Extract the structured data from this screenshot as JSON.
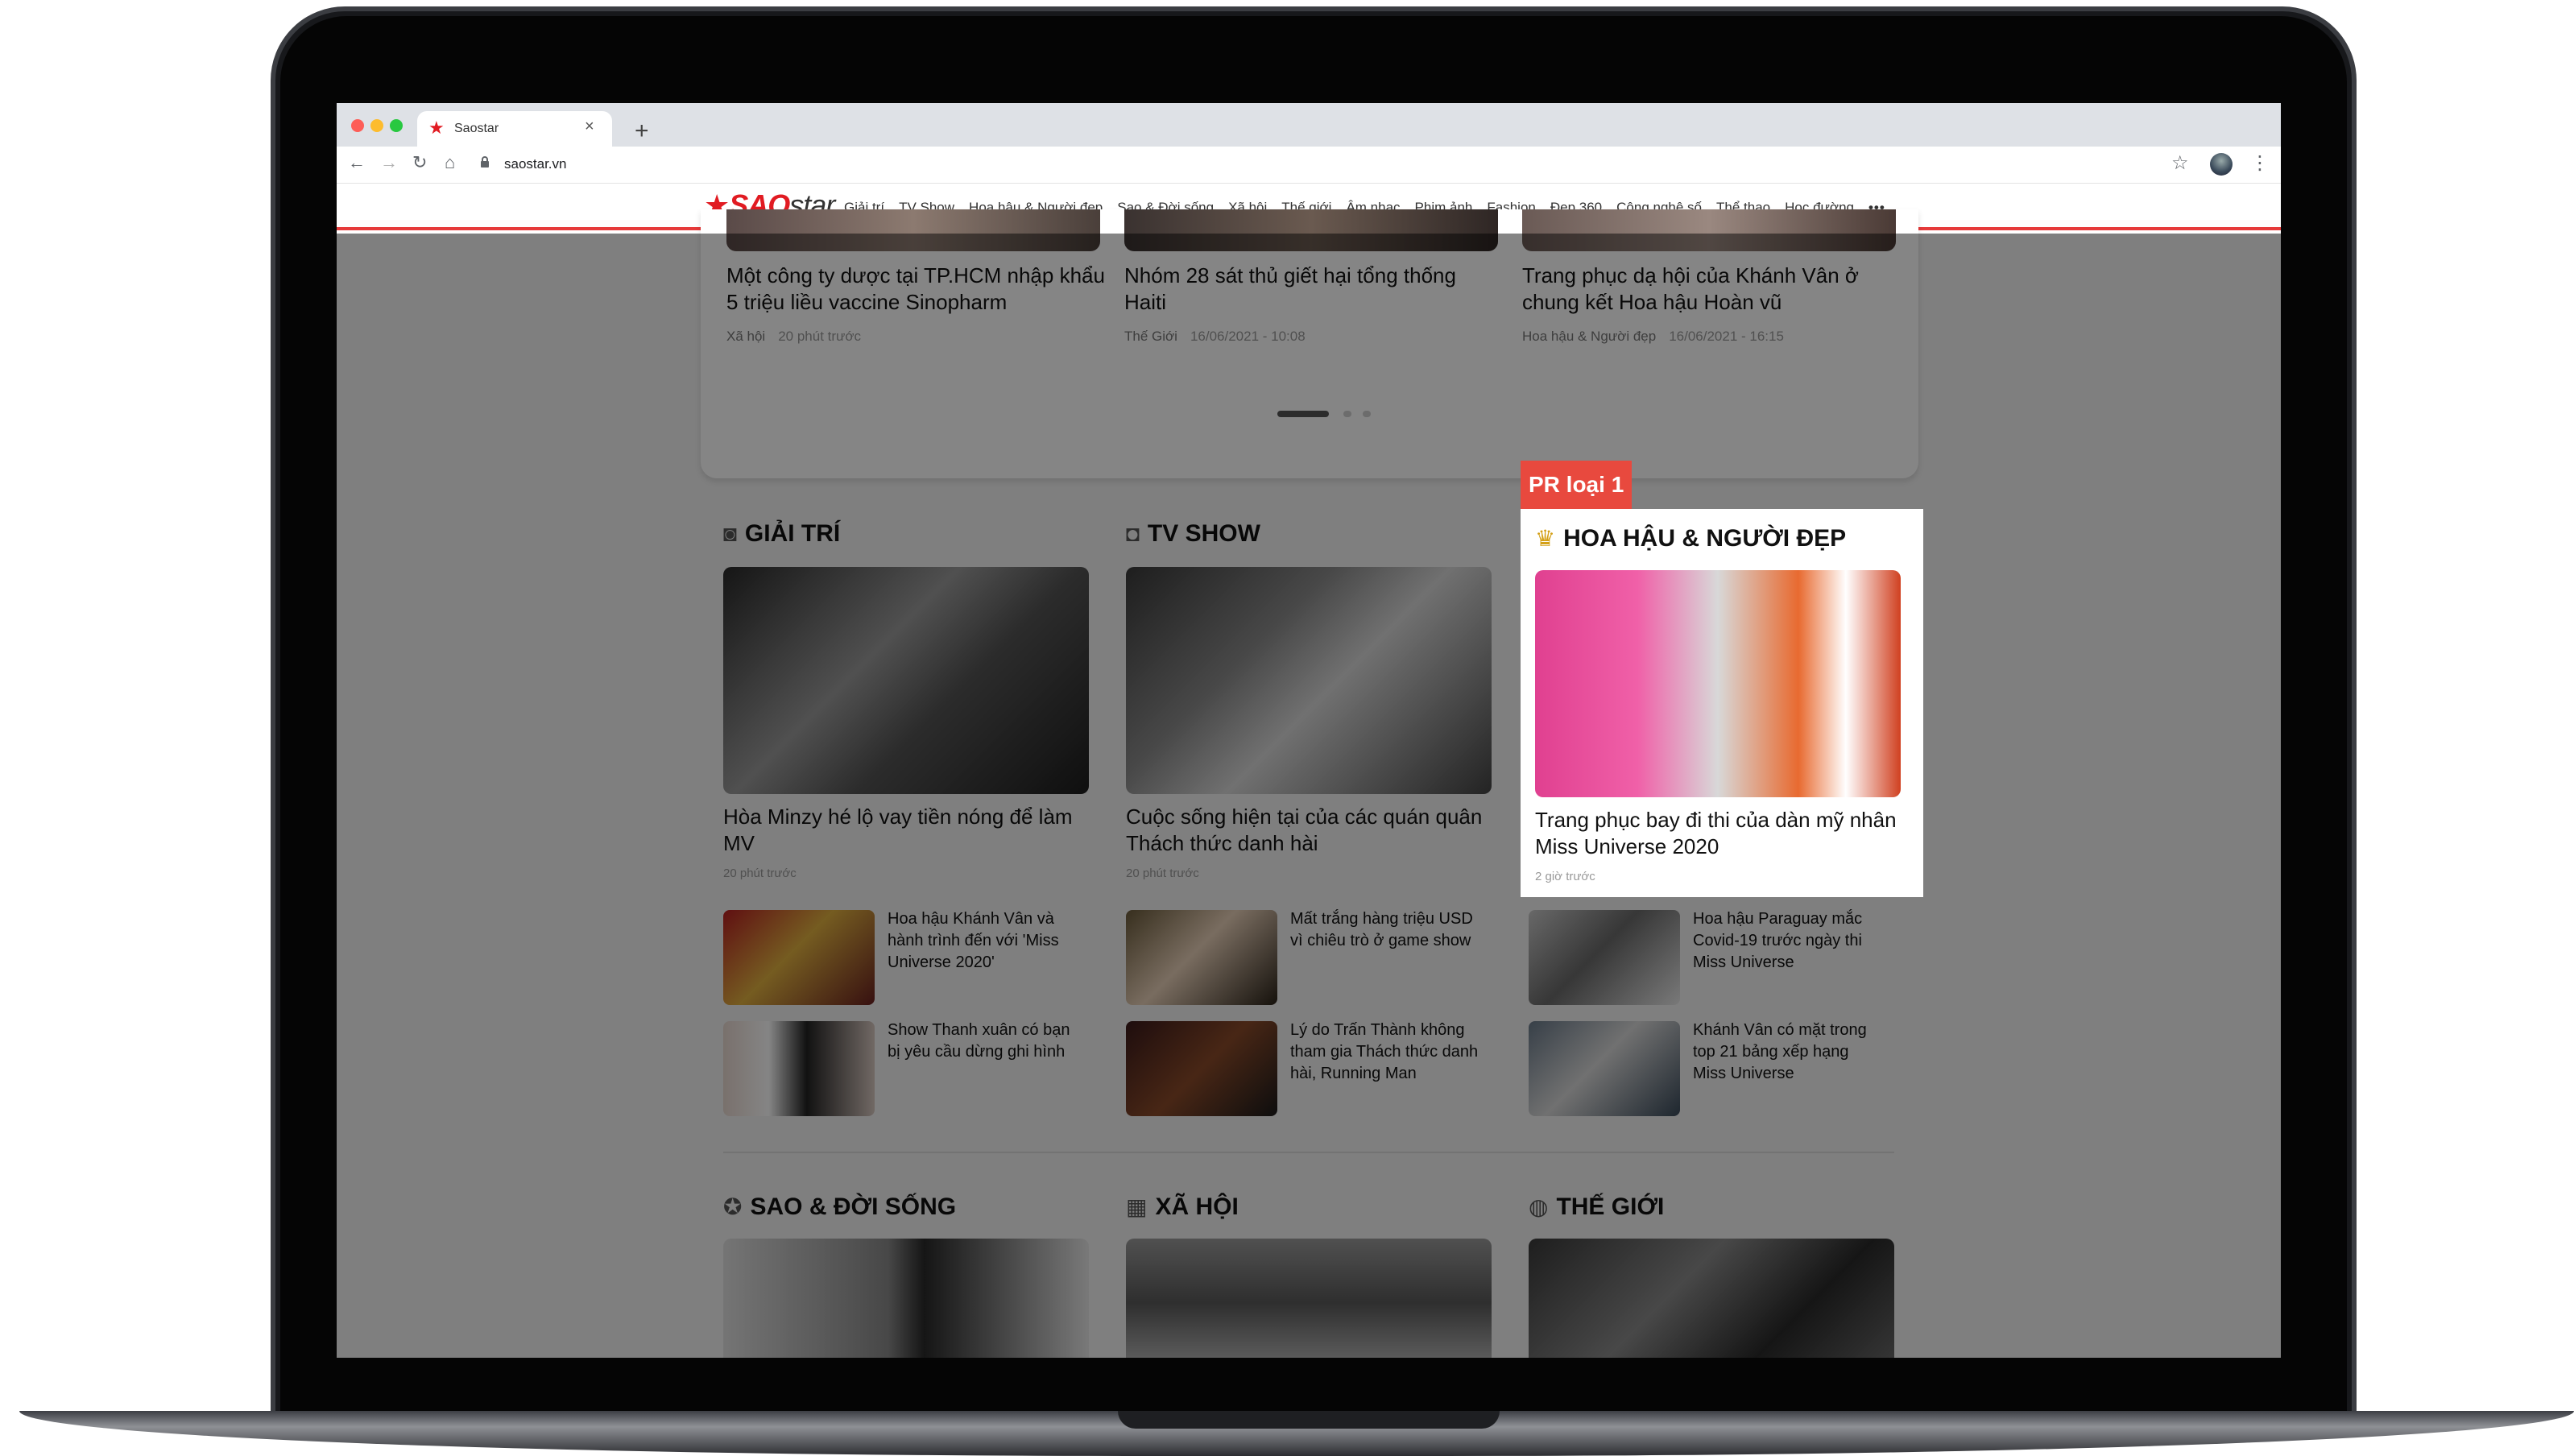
{
  "browser": {
    "tab_title": "Saostar",
    "tab_close": "×",
    "new_tab": "+",
    "url": "saostar.vn",
    "nav": {
      "back": "←",
      "forward": "→",
      "reload": "↻",
      "home": "⌂"
    },
    "lock_icon": "lock-icon",
    "star_icon": "☆",
    "menu_icon": "⋮"
  },
  "site": {
    "logo_star": "★",
    "logo_sao": "SAO",
    "logo_star_text": "star",
    "menu": [
      "Giải trí",
      "TV Show",
      "Hoa hậu & Người đẹp",
      "Sao & Đời sống",
      "Xã hội",
      "Thế giới",
      "Âm nhạc",
      "Phim ảnh",
      "Fashion",
      "Đẹp 360",
      "Công nghệ số",
      "Thể thao",
      "Học đường"
    ],
    "menu_more": "•••",
    "accent": "#e11b22"
  },
  "top_articles": [
    {
      "title": "Một công ty dược tại TP.HCM nhập khẩu 5 triệu liều vaccine Sinopharm",
      "category": "Xã hội",
      "time": "20 phút trước"
    },
    {
      "title": "Nhóm 28 sát thủ giết hại tổng thống Haiti",
      "category": "Thế Giới",
      "time": "16/06/2021 - 10:08"
    },
    {
      "title": "Trang phục dạ hội của Khánh Vân ở chung kết Hoa hậu Hoàn vũ",
      "category": "Hoa hậu & Người đẹp",
      "time": "16/06/2021 - 16:15"
    }
  ],
  "pr_label": "PR loại 1",
  "sections": [
    {
      "icon": "camera-icon",
      "icon_glyph": "◙",
      "title": "GIẢI TRÍ",
      "main_title": "Hòa Minzy hé lộ vay tiền nóng để làm MV",
      "main_time": "20 phút trước",
      "items": [
        "Hoa hậu Khánh Vân và hành trình đến với 'Miss Universe 2020'",
        "Show Thanh xuân có bạn bị yêu cầu dừng ghi hình"
      ]
    },
    {
      "icon": "tv-icon",
      "icon_glyph": "◘",
      "title": "TV SHOW",
      "main_title": "Cuộc sống hiện tại của các quán quân Thách thức danh hài",
      "main_time": "20 phút trước",
      "items": [
        "Mất trắng hàng triệu USD vì chiêu trò ở game show",
        "Lý do Trấn Thành không tham gia Thách thức danh hài, Running Man"
      ]
    },
    {
      "icon": "crown-icon",
      "icon_glyph": "♛",
      "title": "HOA HẬU & NGƯỜI ĐẸP",
      "main_title": "Trang phục bay đi thi của dàn mỹ nhân Miss Universe 2020",
      "main_time": "2 giờ trước",
      "items": [
        "Hoa hậu Paraguay mắc Covid-19 trước ngày thi Miss Universe",
        "Khánh Vân có mặt trong top 21 bảng xếp hạng Miss Universe"
      ]
    }
  ],
  "bottom_sections": [
    {
      "icon": "star-icon",
      "icon_glyph": "✪",
      "title": "SAO & ĐỜI SỐNG"
    },
    {
      "icon": "city-icon",
      "icon_glyph": "▦",
      "title": "XÃ HỘI"
    },
    {
      "icon": "globe-icon",
      "icon_glyph": "◍",
      "title": "THẾ GIỚI"
    }
  ]
}
